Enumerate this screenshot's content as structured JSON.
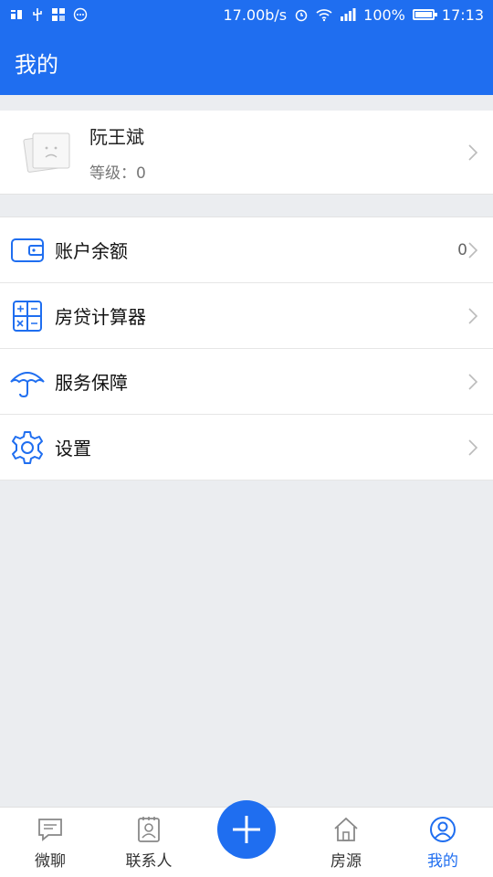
{
  "status_bar": {
    "network_speed": "17.00b/s",
    "battery_percent": "100%",
    "time": "17:13",
    "left_icons": [
      "taobao-icon",
      "usb-icon",
      "grid-icon",
      "more-icon"
    ]
  },
  "header": {
    "title": "我的"
  },
  "profile": {
    "name": "阮王斌",
    "level_label": "等级：",
    "level_value": "0"
  },
  "menu": [
    {
      "label": "账户余额",
      "value": "0",
      "icon": "wallet-icon"
    },
    {
      "label": "房贷计算器",
      "value": "",
      "icon": "calculator-icon"
    },
    {
      "label": "服务保障",
      "value": "",
      "icon": "umbrella-icon"
    },
    {
      "label": "设置",
      "value": "",
      "icon": "gear-icon"
    }
  ],
  "bottom_nav": [
    {
      "label": "微聊",
      "icon": "chat-icon",
      "active": false
    },
    {
      "label": "联系人",
      "icon": "contacts-icon",
      "active": false
    },
    {
      "label": "",
      "icon": "plus-icon",
      "active": false
    },
    {
      "label": "房源",
      "icon": "house-icon",
      "active": false
    },
    {
      "label": "我的",
      "icon": "user-icon",
      "active": true
    }
  ],
  "colors": {
    "primary": "#1f6ef0",
    "background": "#ebedf0",
    "text": "#111111",
    "muted": "#777777"
  }
}
